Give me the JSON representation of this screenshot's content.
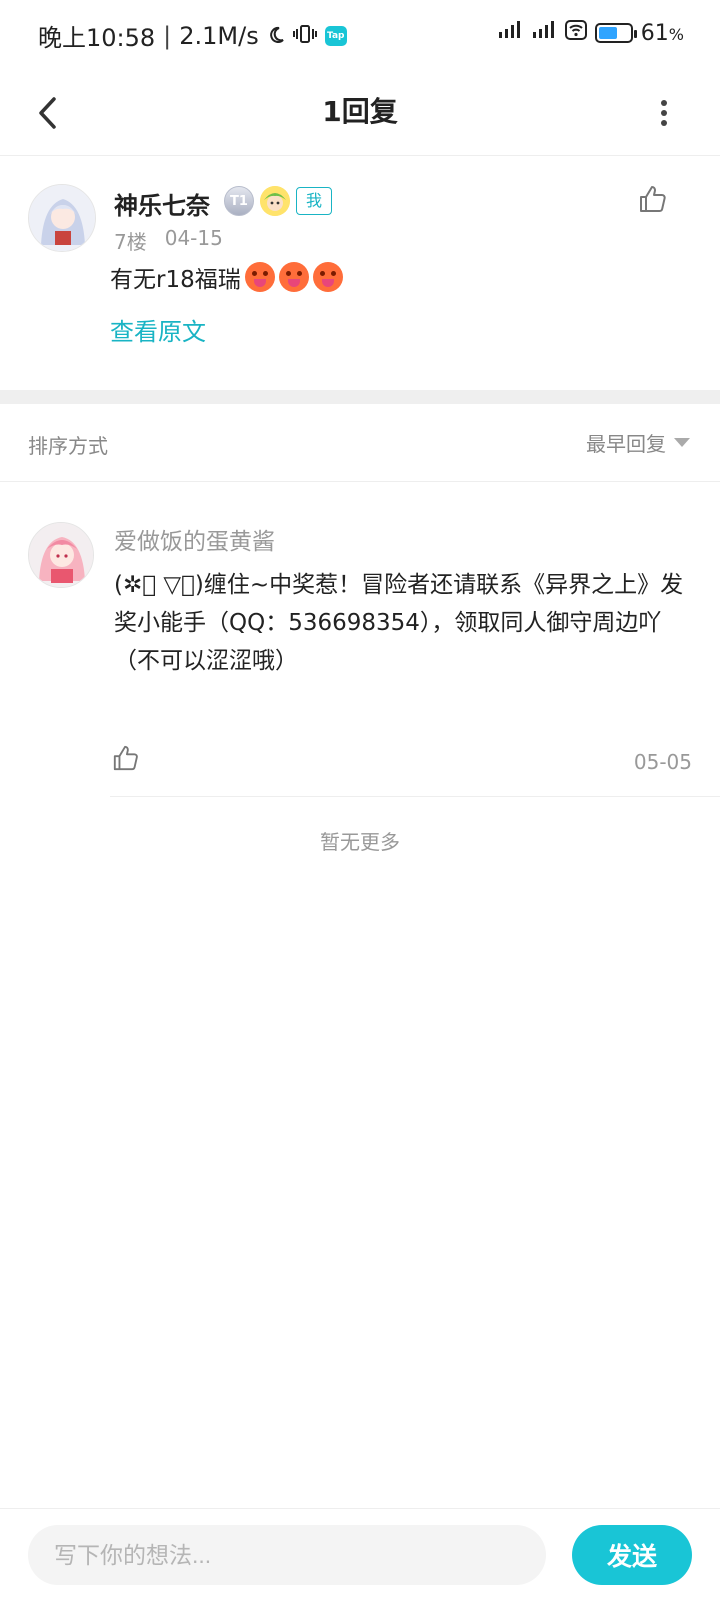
{
  "status_bar": {
    "time": "晚上10:58",
    "speed": "2.1M/s",
    "battery_percent": "61",
    "battery_unit": "%",
    "battery_level": 0.61,
    "app_badge": "Tap"
  },
  "nav": {
    "title": "1回复"
  },
  "post": {
    "username": "神乐七奈",
    "level_badge": "T1",
    "me_badge": "我",
    "floor": "7楼",
    "date": "04-15",
    "content": "有无r18福瑞",
    "emoji_count": 3,
    "view_original": "查看原文"
  },
  "sort": {
    "label": "排序方式",
    "selected": "最早回复"
  },
  "reply": {
    "username": "爱做饭的蛋黄酱",
    "content_lines": [
      "(✲ﾟ ▽ﾟ)缠住~中奖惹！冒险者还请联系《异界之上》发奖小能手（QQ：536698354），领取同人御守周边吖",
      "（不可以涩涩哦）"
    ],
    "date": "05-05"
  },
  "footer_text": "暂无更多",
  "input": {
    "placeholder": "写下你的想法...",
    "send_label": "发送"
  },
  "colors": {
    "accent": "#19c5d6",
    "link": "#19b4c4",
    "muted_text": "#999999"
  }
}
